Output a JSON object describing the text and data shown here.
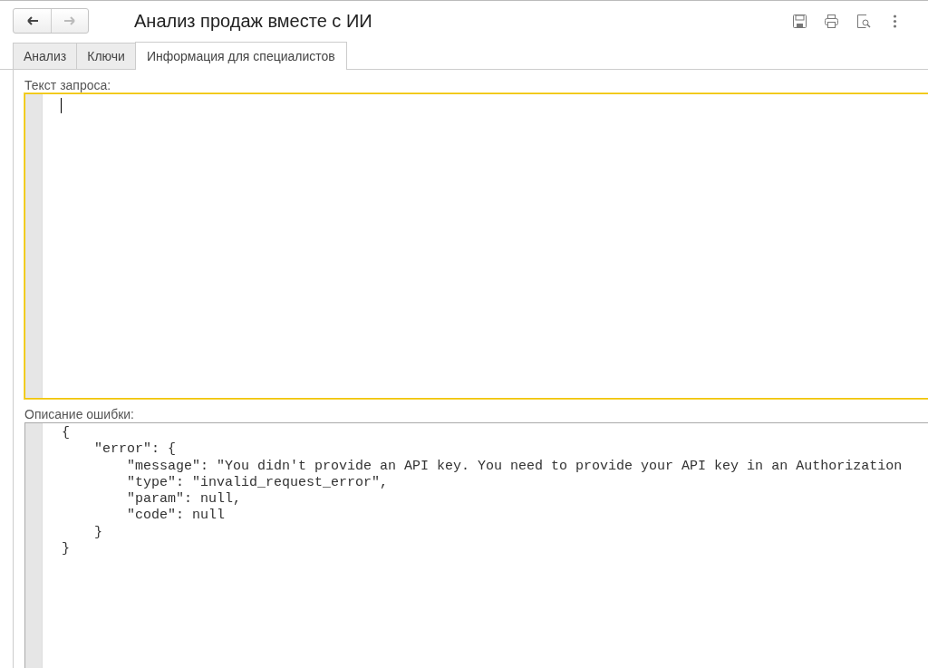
{
  "nav": [
    {
      "kind": "back",
      "disabled": false
    },
    {
      "kind": "forward",
      "disabled": true
    }
  ],
  "window": {
    "title": "Анализ продаж вместе с ИИ"
  },
  "toolbar": [
    {
      "kind": "save"
    },
    {
      "kind": "print"
    },
    {
      "kind": "preview"
    },
    {
      "kind": "more"
    }
  ],
  "tabs": [
    {
      "label": "Анализ",
      "selected": false
    },
    {
      "label": "Ключи",
      "selected": false
    },
    {
      "label": "Информация для специалистов",
      "selected": true
    }
  ],
  "fields": [
    {
      "label": "Текст запроса:",
      "focused": true
    },
    {
      "label": "Описание ошибки:",
      "focused": false,
      "lines": [
        "{",
        "    \"error\": {",
        "        \"message\": \"You didn't provide an API key. You need to provide your API key in an Authorization",
        "        \"type\": \"invalid_request_error\",",
        "        \"param\": null,",
        "        \"code\": null",
        "    }",
        "}"
      ]
    }
  ]
}
